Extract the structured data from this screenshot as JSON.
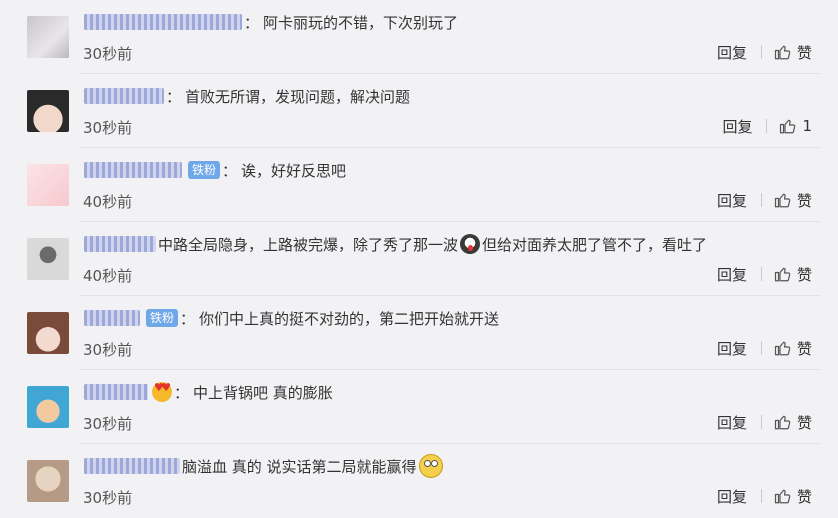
{
  "actions": {
    "reply_label": "回复",
    "like_icon": "thumbs-up-icon"
  },
  "comments": [
    {
      "username_blurred": true,
      "badge": "",
      "text": "阿卡丽玩的不错，下次别玩了",
      "time": "30秒前",
      "like_label": "赞",
      "avatar_colors": [
        "#c9c4c8",
        "#e8e6e8"
      ]
    },
    {
      "username_blurred": true,
      "badge": "",
      "text": "首败无所谓，发现问题，解决问题",
      "time": "30秒前",
      "like_label": "1",
      "avatar_colors": [
        "#2a2a2a",
        "#f1d8c8"
      ]
    },
    {
      "username_blurred": true,
      "badge": "铁粉",
      "text": "诶，好好反思吧",
      "time": "40秒前",
      "like_label": "赞",
      "avatar_colors": [
        "#fbe4e6",
        "#f7c9cf"
      ]
    },
    {
      "username_blurred": true,
      "badge": "",
      "text_before": "中路全局隐身，上路被完爆，除了秀了那一波",
      "text_after": "但给对面养太肥了管不了，看吐了",
      "emoji": "shock-emoji",
      "time": "40秒前",
      "like_label": "赞",
      "avatar_colors": [
        "#d9d9d9",
        "#6b6b6b"
      ]
    },
    {
      "username_blurred": true,
      "badge": "铁粉",
      "text": "你们中上真的挺不对劲的，第二把开始就开送",
      "time": "30秒前",
      "like_label": "赞",
      "avatar_colors": [
        "#7a4a3a",
        "#f3d9cf"
      ]
    },
    {
      "username_blurred": true,
      "badge": "",
      "text": "中上背锅吧 真的膨胀",
      "emoji_before": "heart-eyes-emoji",
      "time": "30秒前",
      "like_label": "赞",
      "avatar_colors": [
        "#3fa6d6",
        "#f3c9a0"
      ]
    },
    {
      "username_blurred": true,
      "badge": "",
      "text": "脑溢血 真的 说实话第二局就能赢得",
      "emoji_after": "eye-roll-emoji",
      "time": "30秒前",
      "like_label": "赞",
      "avatar_colors": [
        "#e7d3c2",
        "#b59a86"
      ]
    }
  ]
}
